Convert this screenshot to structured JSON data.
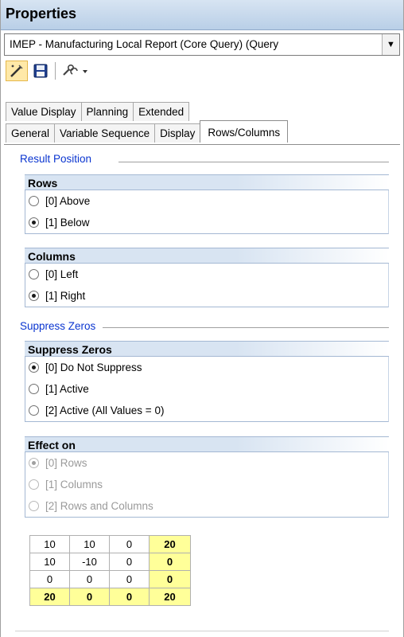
{
  "title": "Properties",
  "query_select": {
    "value": "IMEP - Manufacturing Local Report (Core Query) (Query"
  },
  "toolbar": {
    "buttons": [
      {
        "name": "magic-wand-icon",
        "glyph": "✎"
      },
      {
        "name": "save-icon",
        "glyph": "💾"
      },
      {
        "name": "tools-dropdown-icon",
        "glyph": "🔧▾"
      }
    ]
  },
  "tabs_row1": [
    "Value Display",
    "Planning",
    "Extended"
  ],
  "tabs_row2": [
    "General",
    "Variable Sequence",
    "Display",
    "Rows/Columns"
  ],
  "sections": {
    "result_position": {
      "label": "Result Position",
      "rows": {
        "title": "Rows",
        "options": [
          "[0] Above",
          "[1] Below"
        ],
        "selected": 1
      },
      "columns": {
        "title": "Columns",
        "options": [
          "[0] Left",
          "[1] Right"
        ],
        "selected": 1
      }
    },
    "suppress_zeros": {
      "label": "Suppress Zeros",
      "suppress": {
        "title": "Suppress Zeros",
        "options": [
          "[0] Do Not Suppress",
          "[1] Active",
          "[2] Active (All Values = 0)"
        ],
        "selected": 0
      },
      "effect": {
        "title": "Effect on",
        "options": [
          "[0] Rows",
          "[1] Columns",
          "[2] Rows and Columns"
        ],
        "selected": 0,
        "disabled": true
      }
    }
  },
  "example_table": [
    [
      "10",
      "10",
      "0",
      "20"
    ],
    [
      "10",
      "-10",
      "0",
      "0"
    ],
    [
      "0",
      "0",
      "0",
      "0"
    ],
    [
      "20",
      "0",
      "0",
      "20"
    ]
  ],
  "colors": {
    "section_label": "#0a35d0",
    "group_header": "#d8e4f2",
    "highlight_cell": "#ffff99",
    "title_bar": "#c6d8ec"
  }
}
